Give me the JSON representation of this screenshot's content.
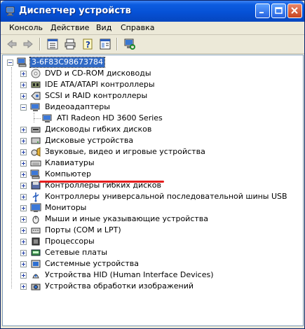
{
  "window": {
    "title": "Диспетчер устройств",
    "accent": "#0651d6"
  },
  "menu": {
    "items": [
      "Консоль",
      "Действие",
      "Вид",
      "Справка"
    ]
  },
  "toolbar": {
    "icons": [
      "back-arrow-icon",
      "forward-arrow-icon",
      "list-view-icon",
      "print-icon",
      "help-icon",
      "properties-icon",
      "scan-hardware-icon"
    ]
  },
  "tree": {
    "root": "3-6F83C98673784",
    "categories": [
      {
        "label": "DVD и CD-ROM дисководы",
        "icon": "cdrom-icon",
        "expanded": false
      },
      {
        "label": "IDE ATA/ATAPI контроллеры",
        "icon": "ide-controller-icon",
        "expanded": false
      },
      {
        "label": "SCSI и RAID контроллеры",
        "icon": "scsi-icon",
        "expanded": false
      },
      {
        "label": "Видеоадаптеры",
        "icon": "display-adapter-icon",
        "expanded": true,
        "children": [
          "ATI Radeon HD 3600 Series"
        ]
      },
      {
        "label": "Дисководы гибких дисков",
        "icon": "floppy-drive-icon",
        "expanded": false
      },
      {
        "label": "Дисковые устройства",
        "icon": "disk-drive-icon",
        "expanded": false
      },
      {
        "label": "Звуковые, видео и игровые устройства",
        "icon": "sound-icon",
        "expanded": false
      },
      {
        "label": "Клавиатуры",
        "icon": "keyboard-icon",
        "expanded": false
      },
      {
        "label": "Компьютер",
        "icon": "computer-icon",
        "expanded": false
      },
      {
        "label": "Контроллеры гибких дисков",
        "icon": "floppy-controller-icon",
        "expanded": false
      },
      {
        "label": "Контроллеры универсальной последовательной шины USB",
        "icon": "usb-icon",
        "expanded": false
      },
      {
        "label": "Мониторы",
        "icon": "monitor-icon",
        "expanded": false
      },
      {
        "label": "Мыши и иные указывающие устройства",
        "icon": "mouse-icon",
        "expanded": false
      },
      {
        "label": "Порты (COM и LPT)",
        "icon": "port-icon",
        "expanded": false
      },
      {
        "label": "Процессоры",
        "icon": "processor-icon",
        "expanded": false
      },
      {
        "label": "Сетевые платы",
        "icon": "network-card-icon",
        "expanded": false
      },
      {
        "label": "Системные устройства",
        "icon": "system-device-icon",
        "expanded": false
      },
      {
        "label": "Устройства HID (Human Interface Devices)",
        "icon": "hid-icon",
        "expanded": false
      },
      {
        "label": "Устройства обработки изображений",
        "icon": "imaging-device-icon",
        "expanded": false
      }
    ]
  },
  "colors": {
    "selection": "#316ac5",
    "annotation_underline": "#e51d1d"
  }
}
